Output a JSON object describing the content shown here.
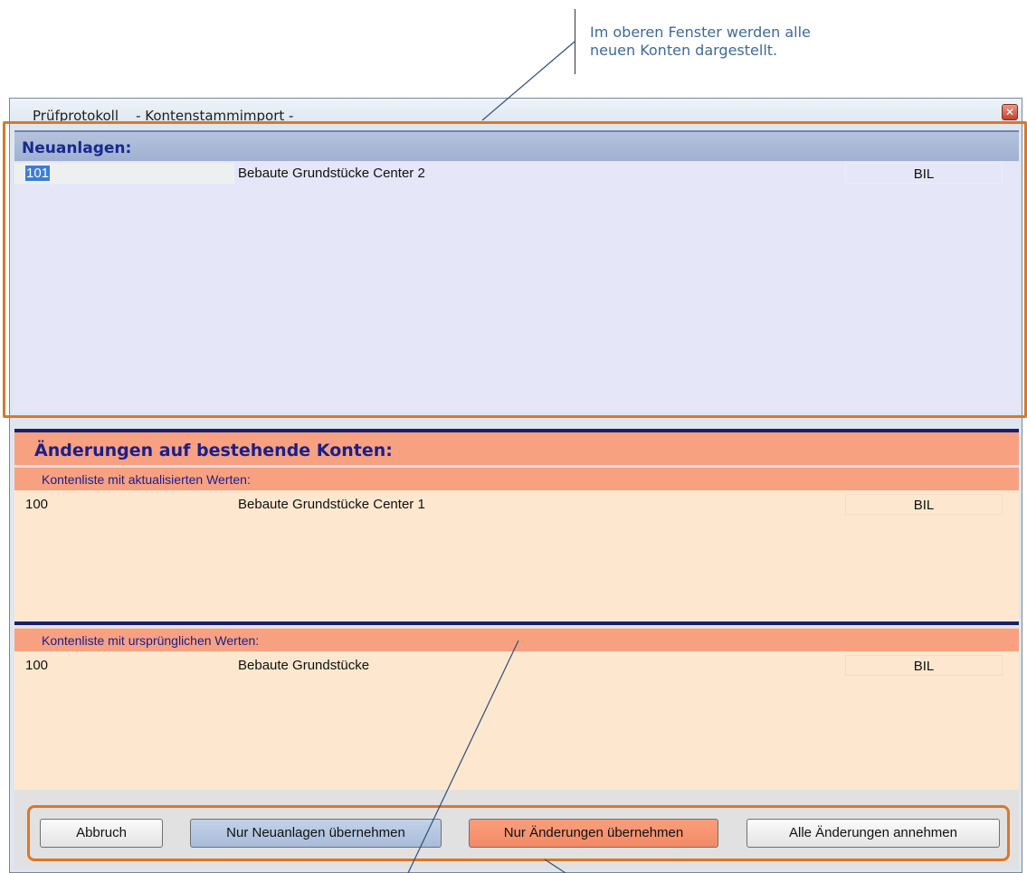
{
  "callout": {
    "line1": "Im oberen Fenster werden alle",
    "line2": "neuen Konten dargestellt."
  },
  "window": {
    "title": "Prüfprotokoll    - Kontenstammimport -",
    "close_icon": "close-icon"
  },
  "new_section": {
    "title": "Neuanlagen:",
    "rows": [
      {
        "number": "101",
        "name": "Bebaute Grundstücke Center 2",
        "type": "BIL"
      }
    ]
  },
  "changes_section": {
    "title": "Änderungen auf bestehende Konten:",
    "updated": {
      "label": "Kontenliste mit aktualisierten Werten:",
      "rows": [
        {
          "number": "100",
          "name": "Bebaute Grundstücke Center 1",
          "type": "BIL"
        }
      ]
    },
    "original": {
      "label": "Kontenliste mit ursprünglichen Werten:",
      "rows": [
        {
          "number": "100",
          "name": "Bebaute Grundstücke",
          "type": "BIL"
        }
      ]
    }
  },
  "buttons": {
    "cancel": "Abbruch",
    "only_new": "Nur Neuanlagen übernehmen",
    "only_changes": "Nur Änderungen übernehmen",
    "accept_all": "Alle Änderungen annehmen"
  },
  "colors": {
    "highlight": "#d9782b",
    "new_panel": "#e5e6f7",
    "changes_header": "#f8a181",
    "changes_list": "#fde8cf"
  }
}
